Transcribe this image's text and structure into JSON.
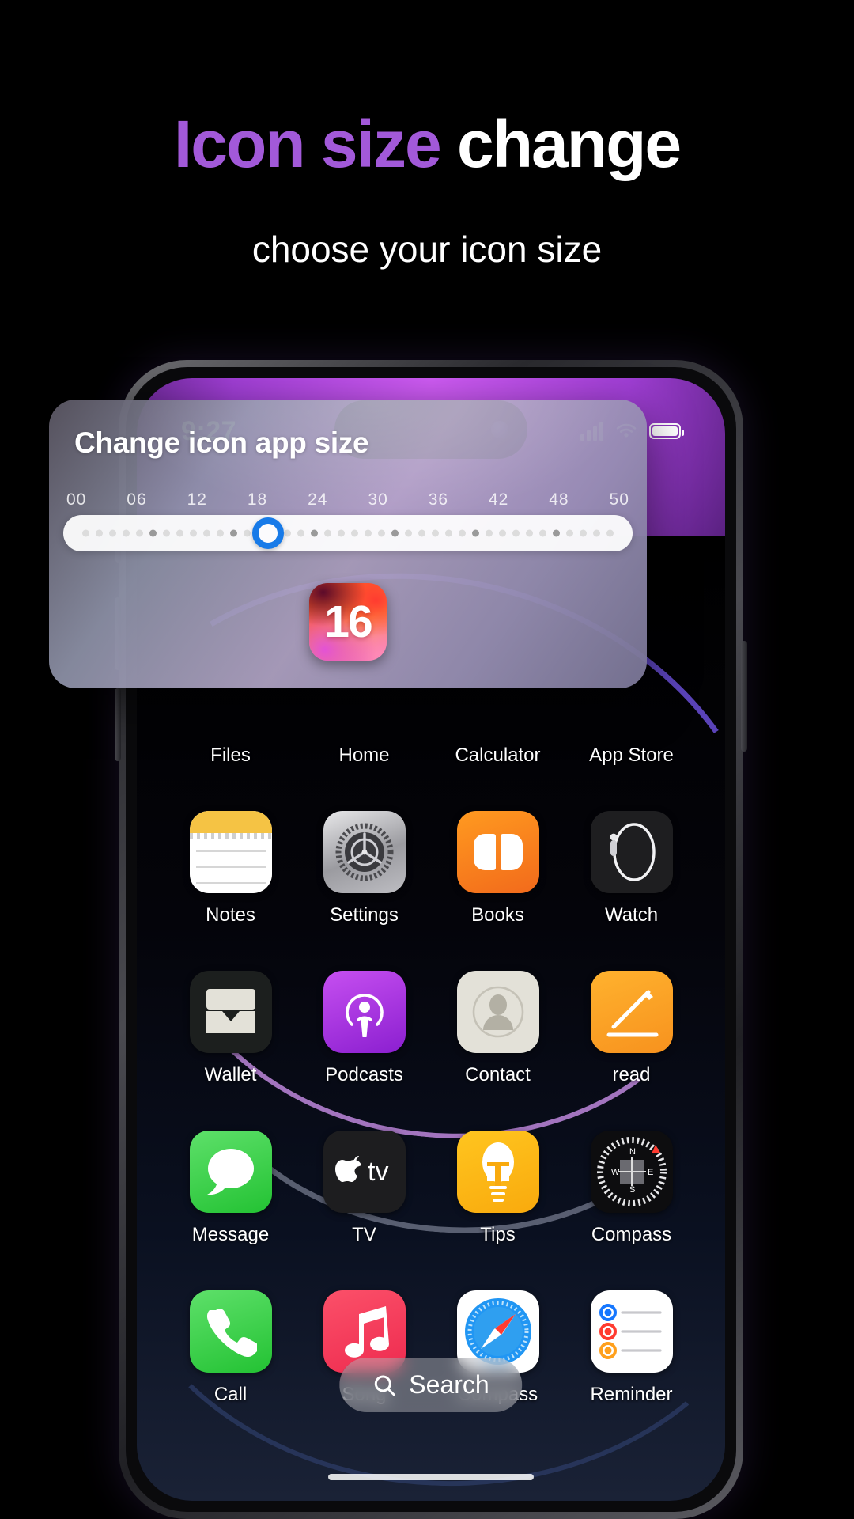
{
  "header": {
    "title_part1": "Icon size ",
    "title_part2": "change",
    "subtitle": "choose your icon size",
    "accent_purple": "#a259d9",
    "accent_white": "#ffffff"
  },
  "phone": {
    "status_bar": {
      "time": "9:27",
      "cellular_icon": "signal-bars-icon",
      "wifi_icon": "wifi-icon",
      "battery_icon": "battery-icon"
    },
    "search": {
      "label": "Search",
      "icon": "search-icon"
    }
  },
  "dialog": {
    "title": "Change icon app size",
    "ruler_labels": [
      "00",
      "06",
      "12",
      "18",
      "24",
      "30",
      "36",
      "42",
      "48",
      "50"
    ],
    "slider": {
      "value": 18,
      "min": 0,
      "max": 50,
      "knob_color": "#177ae8",
      "track_color": "#ffffff",
      "dot_count": 40,
      "knob_position_percent": 36
    },
    "preview": {
      "label": "16",
      "icon_name": "ios16-app-icon"
    }
  },
  "apps": {
    "row0_labels": [
      "Files",
      "Home",
      "Calculator",
      "App Store"
    ],
    "rows": [
      [
        {
          "label": "Notes",
          "icon": "notes-icon"
        },
        {
          "label": "Settings",
          "icon": "settings-gear-icon"
        },
        {
          "label": "Books",
          "icon": "books-icon"
        },
        {
          "label": "Watch",
          "icon": "watch-icon"
        }
      ],
      [
        {
          "label": "Wallet",
          "icon": "wallet-icon"
        },
        {
          "label": "Podcasts",
          "icon": "podcasts-icon"
        },
        {
          "label": "Contact",
          "icon": "contacts-icon"
        },
        {
          "label": "read",
          "icon": "pencil-notes-icon"
        }
      ],
      [
        {
          "label": "Message",
          "icon": "messages-bubble-icon"
        },
        {
          "label": "TV",
          "icon": "apple-tv-icon"
        },
        {
          "label": "Tips",
          "icon": "lightbulb-tips-icon"
        },
        {
          "label": "Compass",
          "icon": "compass-dial-icon"
        }
      ],
      [
        {
          "label": "Call",
          "icon": "phone-handset-icon"
        },
        {
          "label": "Song",
          "icon": "music-note-icon"
        },
        {
          "label": "Compass",
          "icon": "safari-compass-icon"
        },
        {
          "label": "Reminder",
          "icon": "reminders-list-icon"
        }
      ]
    ]
  }
}
